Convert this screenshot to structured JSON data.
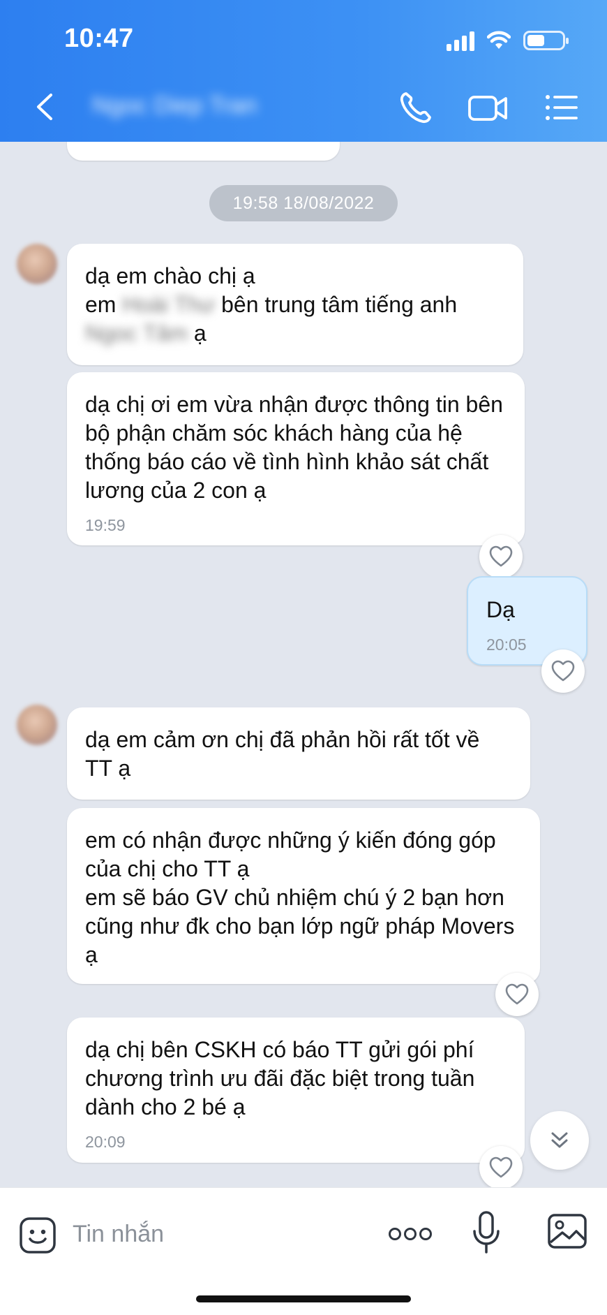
{
  "status_bar": {
    "time": "10:47"
  },
  "header": {
    "contact_name": "Ngoc Diep Tran"
  },
  "chat": {
    "date_separator": "19:58 18/08/2022",
    "messages": [
      {
        "line1": "dạ em chào chị ạ",
        "line2_prefix": "em",
        "line2_name": "Hoài Thư",
        "line2_suffix": "bên trung tâm tiếng anh",
        "line3_name": "Ngoc Tâm",
        "line3_suffix": "ạ"
      },
      {
        "text": "dạ chị ơi em vừa nhận được thông tin bên bộ phận chăm sóc khách hàng của hệ thống báo cáo về tình hình khảo sát chất lương của 2 con ạ",
        "time": "19:59"
      },
      {
        "text": "Dạ",
        "time": "20:05"
      },
      {
        "text": "dạ em cảm ơn chị đã phản hồi rất tốt về TT ạ"
      },
      {
        "line1": "em có nhận được những ý kiến đóng góp của chị cho TT ạ",
        "line2": "em sẽ báo GV chủ nhiệm chú ý 2 bạn hơn cũng như đk cho bạn lớp ngữ pháp Movers ạ"
      },
      {
        "text": "dạ chị bên CSKH có báo TT gửi gói phí chương trình ưu đãi đặc biệt trong tuần dành cho 2 bé ạ",
        "time": "20:09"
      }
    ]
  },
  "input_bar": {
    "placeholder": "Tin nhắn"
  }
}
